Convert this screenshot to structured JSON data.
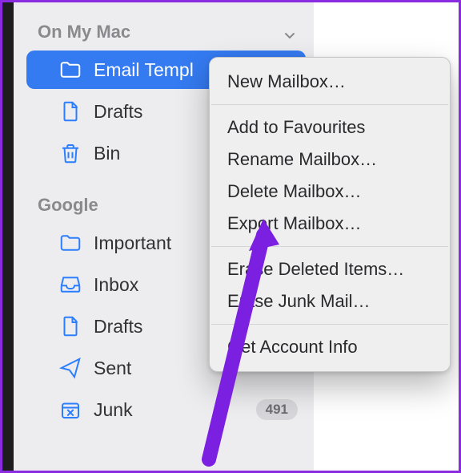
{
  "sections": [
    {
      "title": "On My Mac",
      "items": [
        {
          "label": "Email Templ",
          "icon": "folder",
          "selected": true
        },
        {
          "label": "Drafts",
          "icon": "doc"
        },
        {
          "label": "Bin",
          "icon": "trash"
        }
      ]
    },
    {
      "title": "Google",
      "items": [
        {
          "label": "Important",
          "icon": "folder"
        },
        {
          "label": "Inbox",
          "icon": "tray"
        },
        {
          "label": "Drafts",
          "icon": "doc"
        },
        {
          "label": "Sent",
          "icon": "paperplane"
        },
        {
          "label": "Junk",
          "icon": "junkbox",
          "badge": "491"
        }
      ]
    }
  ],
  "context_menu": {
    "groups": [
      [
        "New Mailbox…"
      ],
      [
        "Add to Favourites",
        "Rename Mailbox…",
        "Delete Mailbox…",
        "Export Mailbox…"
      ],
      [
        "Erase Deleted Items…",
        "Erase Junk Mail…"
      ],
      [
        "Get Account Info"
      ]
    ]
  },
  "colors": {
    "accent": "#347af0",
    "arrow": "#7b1fe0"
  }
}
